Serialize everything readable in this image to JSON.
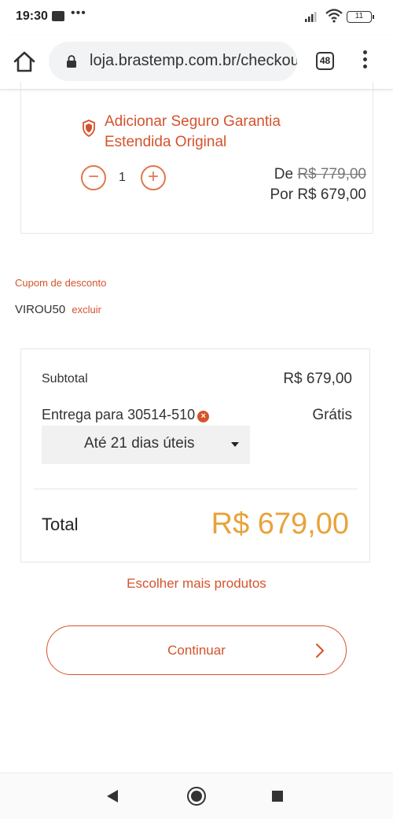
{
  "status_bar": {
    "time": "19:30",
    "dots": "•••",
    "battery": "11"
  },
  "browser": {
    "url": "loja.brastemp.com.br/checkout",
    "tab_count": "48"
  },
  "warranty": {
    "title": "Adicionar Seguro Garantia Estendida Original",
    "quantity": "1",
    "minus_label": "−",
    "plus_label": "+",
    "price_from_prefix": "De",
    "price_from": "R$ 779,00",
    "price_to": "Por R$ 679,00"
  },
  "coupon": {
    "label": "Cupom de desconto",
    "code": "VIROU50",
    "remove_label": "excluir"
  },
  "summary": {
    "subtotal_label": "Subtotal",
    "subtotal_value": "R$ 679,00",
    "delivery_label": "Entrega para 30514-510",
    "delivery_value": "Grátis",
    "delivery_option": "Até 21 dias úteis",
    "total_label": "Total",
    "total_value": "R$ 679,00"
  },
  "actions": {
    "more_products": "Escolher mais produtos",
    "continue": "Continuar"
  },
  "colors": {
    "accent": "#d4532c",
    "total": "#e8a33c"
  }
}
